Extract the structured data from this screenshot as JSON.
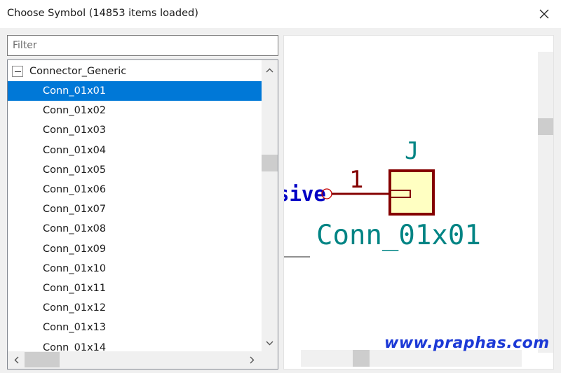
{
  "window": {
    "title": "Choose Symbol (14853 items loaded)"
  },
  "filter": {
    "placeholder": "Filter",
    "value": ""
  },
  "tree": {
    "group_label": "Connector_Generic",
    "group_expanded": true,
    "items": [
      {
        "label": "Conn_01x01",
        "selected": true
      },
      {
        "label": "Conn_01x02",
        "selected": false
      },
      {
        "label": "Conn_01x03",
        "selected": false
      },
      {
        "label": "Conn_01x04",
        "selected": false
      },
      {
        "label": "Conn_01x05",
        "selected": false
      },
      {
        "label": "Conn_01x06",
        "selected": false
      },
      {
        "label": "Conn_01x07",
        "selected": false
      },
      {
        "label": "Conn_01x08",
        "selected": false
      },
      {
        "label": "Conn_01x09",
        "selected": false
      },
      {
        "label": "Conn_01x10",
        "selected": false
      },
      {
        "label": "Conn_01x11",
        "selected": false
      },
      {
        "label": "Conn_01x12",
        "selected": false
      },
      {
        "label": "Conn_01x13",
        "selected": false
      },
      {
        "label": "Conn_01x14",
        "selected": false
      }
    ]
  },
  "preview": {
    "reference": "J",
    "value": "Conn_01x01",
    "pin_number": "1",
    "pin_type_fragment": "sive"
  },
  "watermark": "www.praphas.com",
  "colors": {
    "selection": "#0078d7",
    "schematic_body_fill": "#ffffc2",
    "schematic_body_stroke": "#840000",
    "schematic_text": "#008484",
    "pin_type_text": "#0000c4",
    "watermark": "#1c39d6"
  },
  "icons": {
    "close": "close-icon",
    "expander": "collapse-icon",
    "scroll_up": "chevron-up-icon",
    "scroll_down": "chevron-down-icon",
    "scroll_left": "chevron-left-icon",
    "scroll_right": "chevron-right-icon"
  }
}
